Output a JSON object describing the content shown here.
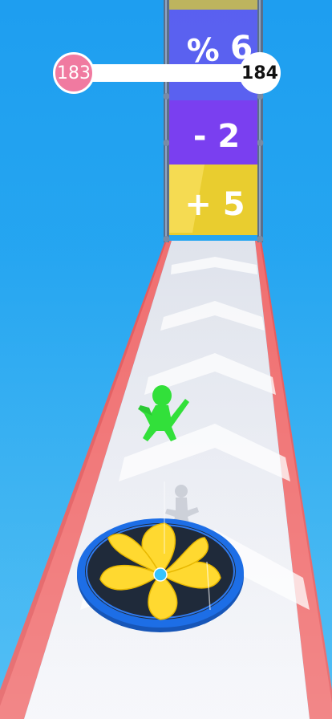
{
  "hud": {
    "current_level": "183",
    "next_level": "184",
    "progress": 0.0
  },
  "gates": [
    {
      "label": "% 6",
      "color": "#8a2ef0",
      "opacity": 0.55
    },
    {
      "label": "- 2",
      "color": "#8a2ef0",
      "opacity": 0.85
    },
    {
      "label": "+ 5",
      "color": "#ffd21a",
      "opacity": 0.9
    }
  ],
  "colors": {
    "sky": "#1fa3ee",
    "track": "#ebedf3",
    "rail": "#f06f70",
    "player": "#32e03a",
    "fan_ring": "#1d6ee6",
    "fan_blade": "#ffd930",
    "gate_post": "#5b6f8a"
  },
  "icons": {
    "player": "stickman-icon",
    "obstacle": "fan-icon"
  }
}
